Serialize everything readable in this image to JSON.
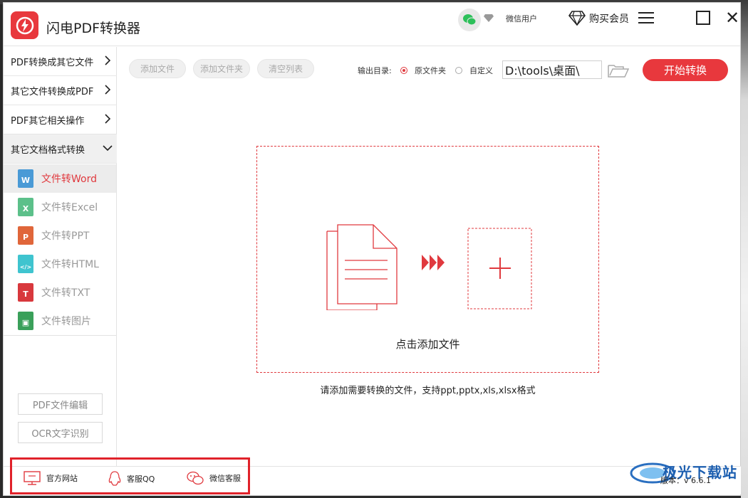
{
  "app": {
    "title": "闪电PDF转换器",
    "user_name": "微信用户",
    "vip_label": "购买会员"
  },
  "sidebar": {
    "groups": [
      {
        "label": "PDF转换成其它文件"
      },
      {
        "label": "其它文件转换成PDF"
      },
      {
        "label": "PDF其它相关操作"
      },
      {
        "label": "其它文档格式转换"
      }
    ],
    "sub_items": [
      {
        "label": "文件转Word",
        "icon": "word-icon",
        "letter": "W",
        "color": "#4a9ad6"
      },
      {
        "label": "文件转Excel",
        "icon": "excel-icon",
        "letter": "X",
        "color": "#5cc08a"
      },
      {
        "label": "文件转PPT",
        "icon": "ppt-icon",
        "letter": "P",
        "color": "#e0663a"
      },
      {
        "label": "文件转HTML",
        "icon": "html-icon",
        "letter": "</>",
        "color": "#3fc4cf"
      },
      {
        "label": "文件转TXT",
        "icon": "txt-icon",
        "letter": "T",
        "color": "#d8383d"
      },
      {
        "label": "文件转图片",
        "icon": "image-icon",
        "letter": "▣",
        "color": "#3aa05a"
      }
    ],
    "bottom_buttons": [
      {
        "label": "PDF文件编辑"
      },
      {
        "label": "OCR文字识别"
      }
    ]
  },
  "toolbar": {
    "add_file": "添加文件",
    "add_folder": "添加文件夹",
    "clear_list": "清空列表",
    "output_label": "输出目录:",
    "option_original": "原文件夹",
    "option_custom": "自定义",
    "path_value": "D:\\tools\\桌面\\",
    "start": "开始转换"
  },
  "dropzone": {
    "text": "点击添加文件",
    "hint": "请添加需要转换的文件，支持ppt,pptx,xls,xlsx格式"
  },
  "footer": {
    "links": [
      {
        "label": "官方网站",
        "icon": "monitor-icon"
      },
      {
        "label": "客服QQ",
        "icon": "qq-icon"
      },
      {
        "label": "微信客服",
        "icon": "wechat-icon"
      }
    ],
    "version": "版本：v 6.6.1",
    "watermark": "极光下载站"
  },
  "colors": {
    "accent": "#e8383d",
    "accent_text": "#e0393e",
    "highlight": "#e0222a"
  }
}
